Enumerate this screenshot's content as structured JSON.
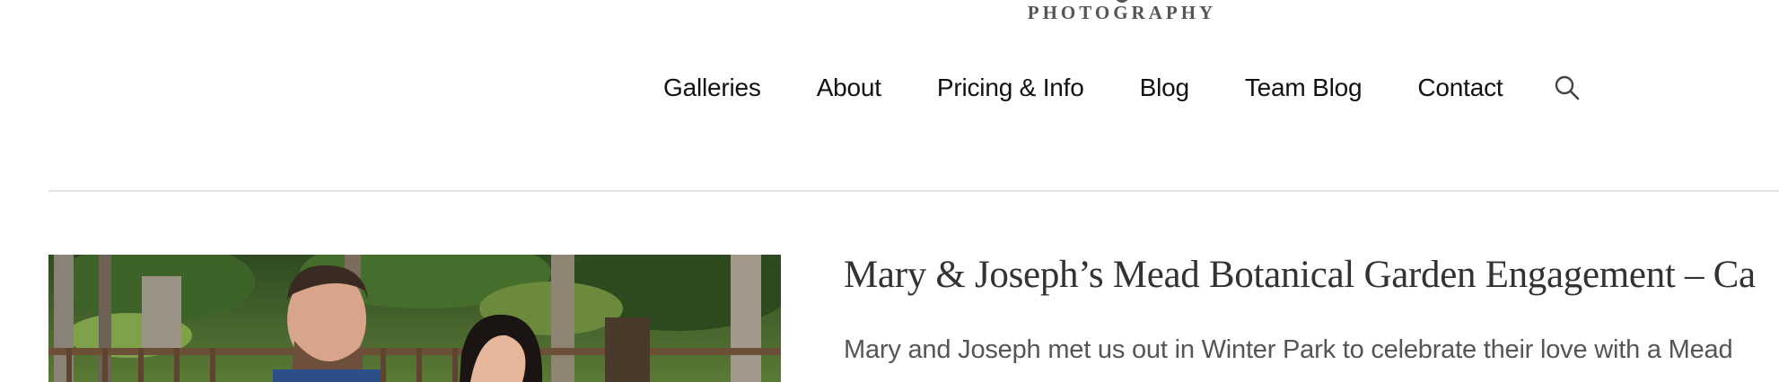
{
  "header": {
    "logo_subtitle": "PHOTOGRAPHY"
  },
  "nav": {
    "items": [
      {
        "label": "Galleries"
      },
      {
        "label": "About"
      },
      {
        "label": "Pricing & Info"
      },
      {
        "label": "Blog"
      },
      {
        "label": "Team Blog"
      },
      {
        "label": "Contact"
      }
    ],
    "search_icon": "search-icon"
  },
  "post": {
    "image_subject": "engagement-photo",
    "title": "Mary & Joseph’s Mead Botanical Garden Engagement – Ca",
    "excerpt": "Mary and Joseph met us out in Winter Park to celebrate their love with a Mead"
  },
  "colors": {
    "nav_text": "#111111",
    "title_text": "#333333",
    "excerpt_text": "#555555",
    "divider": "#e4e4e4"
  }
}
